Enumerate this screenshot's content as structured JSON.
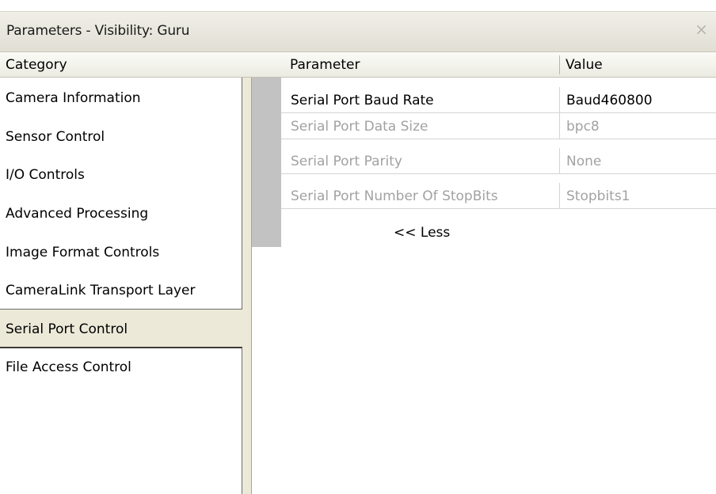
{
  "window": {
    "title": "Parameters - Visibility: Guru",
    "close_glyph": "×",
    "close_icon": "close-icon"
  },
  "header": {
    "category": "Category",
    "parameter": "Parameter",
    "value": "Value"
  },
  "categories": [
    "Camera Information",
    "Sensor Control",
    "I/O Controls",
    "Advanced Processing",
    "Image Format Controls",
    "CameraLink Transport Layer",
    "Serial Port Control",
    "File Access Control"
  ],
  "selected_category": "Serial Port Control",
  "parameters": [
    {
      "name": "Serial Port Baud Rate",
      "value": "Baud460800",
      "enabled": true
    },
    {
      "name": "Serial Port Data Size",
      "value": "bpc8",
      "enabled": false
    },
    {
      "name": "Serial Port Parity",
      "value": "None",
      "enabled": false
    },
    {
      "name": "Serial Port Number Of StopBits",
      "value": "Stopbits1",
      "enabled": false
    }
  ],
  "less_link": "<< Less",
  "colors": {
    "window_bg": "#ece9d8",
    "disabled_text": "#a2a2a2",
    "gutter": "#c2c2c2"
  }
}
